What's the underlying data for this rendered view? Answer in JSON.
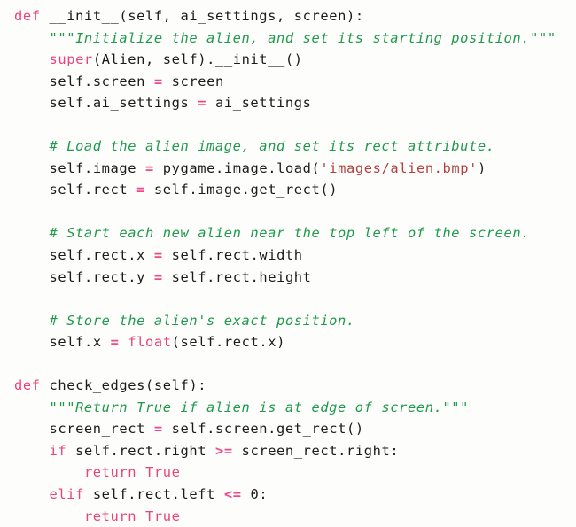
{
  "document": {
    "kind": "code-listing",
    "language": "python",
    "theme": {
      "background": "#fdfdfb",
      "default_text": "#1b1b1b",
      "keyword": "#e8437f",
      "builtin": "#e8437f",
      "operator": "#f0488a",
      "comment": "#1f9a4d",
      "docstring": "#1f9a4d",
      "string": "#b3403f",
      "number": "#1b1b1b"
    },
    "plain_text": "def __init__(self, ai_settings, screen):\n    \"\"\"Initialize the alien, and set its starting position.\"\"\"\n    super(Alien, self).__init__()\n    self.screen = screen\n    self.ai_settings = ai_settings\n\n    # Load the alien image, and set its rect attribute.\n    self.image = pygame.image.load('images/alien.bmp')\n    self.rect = self.image.get_rect()\n\n    # Start each new alien near the top left of the screen.\n    self.rect.x = self.rect.width\n    self.rect.y = self.rect.height\n\n    # Store the alien's exact position.\n    self.x = float(self.rect.x)\n\ndef check_edges(self):\n    \"\"\"Return True if alien is at edge of screen.\"\"\"\n    screen_rect = self.screen.get_rect()\n    if self.rect.right >= screen_rect.right:\n        return True\n    elif self.rect.left <= 0:\n        return True",
    "lines": [
      {
        "index": 1,
        "indent": 0,
        "tokens": [
          {
            "t": "def",
            "k": "kw"
          },
          {
            "t": " ",
            "k": "plain"
          },
          {
            "t": "__init__",
            "k": "name"
          },
          {
            "t": "(",
            "k": "punct"
          },
          {
            "t": "self",
            "k": "name"
          },
          {
            "t": ", ",
            "k": "punct"
          },
          {
            "t": "ai_settings",
            "k": "name"
          },
          {
            "t": ", ",
            "k": "punct"
          },
          {
            "t": "screen",
            "k": "name"
          },
          {
            "t": "):",
            "k": "punct"
          }
        ]
      },
      {
        "index": 2,
        "indent": 1,
        "tokens": [
          {
            "t": "\"\"\"Initialize the alien, and set its starting position.\"\"\"",
            "k": "doc"
          }
        ]
      },
      {
        "index": 3,
        "indent": 1,
        "tokens": [
          {
            "t": "super",
            "k": "builtin"
          },
          {
            "t": "(",
            "k": "punct"
          },
          {
            "t": "Alien",
            "k": "name"
          },
          {
            "t": ", ",
            "k": "punct"
          },
          {
            "t": "self",
            "k": "name"
          },
          {
            "t": ").",
            "k": "punct"
          },
          {
            "t": "__init__",
            "k": "name"
          },
          {
            "t": "()",
            "k": "punct"
          }
        ]
      },
      {
        "index": 4,
        "indent": 1,
        "tokens": [
          {
            "t": "self",
            "k": "name"
          },
          {
            "t": ".",
            "k": "punct"
          },
          {
            "t": "screen",
            "k": "name"
          },
          {
            "t": " ",
            "k": "plain"
          },
          {
            "t": "=",
            "k": "op"
          },
          {
            "t": " ",
            "k": "plain"
          },
          {
            "t": "screen",
            "k": "name"
          }
        ]
      },
      {
        "index": 5,
        "indent": 1,
        "tokens": [
          {
            "t": "self",
            "k": "name"
          },
          {
            "t": ".",
            "k": "punct"
          },
          {
            "t": "ai_settings",
            "k": "name"
          },
          {
            "t": " ",
            "k": "plain"
          },
          {
            "t": "=",
            "k": "op"
          },
          {
            "t": " ",
            "k": "plain"
          },
          {
            "t": "ai_settings",
            "k": "name"
          }
        ]
      },
      {
        "index": 6,
        "indent": 0,
        "blank": true,
        "tokens": []
      },
      {
        "index": 7,
        "indent": 1,
        "tokens": [
          {
            "t": "# Load the alien image, and set its rect attribute.",
            "k": "comment"
          }
        ]
      },
      {
        "index": 8,
        "indent": 1,
        "tokens": [
          {
            "t": "self",
            "k": "name"
          },
          {
            "t": ".",
            "k": "punct"
          },
          {
            "t": "image",
            "k": "name"
          },
          {
            "t": " ",
            "k": "plain"
          },
          {
            "t": "=",
            "k": "op"
          },
          {
            "t": " ",
            "k": "plain"
          },
          {
            "t": "pygame",
            "k": "name"
          },
          {
            "t": ".",
            "k": "punct"
          },
          {
            "t": "image",
            "k": "name"
          },
          {
            "t": ".",
            "k": "punct"
          },
          {
            "t": "load",
            "k": "name"
          },
          {
            "t": "(",
            "k": "punct"
          },
          {
            "t": "'images/alien.bmp'",
            "k": "str"
          },
          {
            "t": ")",
            "k": "punct"
          }
        ]
      },
      {
        "index": 9,
        "indent": 1,
        "tokens": [
          {
            "t": "self",
            "k": "name"
          },
          {
            "t": ".",
            "k": "punct"
          },
          {
            "t": "rect",
            "k": "name"
          },
          {
            "t": " ",
            "k": "plain"
          },
          {
            "t": "=",
            "k": "op"
          },
          {
            "t": " ",
            "k": "plain"
          },
          {
            "t": "self",
            "k": "name"
          },
          {
            "t": ".",
            "k": "punct"
          },
          {
            "t": "image",
            "k": "name"
          },
          {
            "t": ".",
            "k": "punct"
          },
          {
            "t": "get_rect",
            "k": "name"
          },
          {
            "t": "()",
            "k": "punct"
          }
        ]
      },
      {
        "index": 10,
        "indent": 0,
        "blank": true,
        "tokens": []
      },
      {
        "index": 11,
        "indent": 1,
        "tokens": [
          {
            "t": "# Start each new alien near the top left of the screen.",
            "k": "comment"
          }
        ]
      },
      {
        "index": 12,
        "indent": 1,
        "tokens": [
          {
            "t": "self",
            "k": "name"
          },
          {
            "t": ".",
            "k": "punct"
          },
          {
            "t": "rect",
            "k": "name"
          },
          {
            "t": ".",
            "k": "punct"
          },
          {
            "t": "x",
            "k": "name"
          },
          {
            "t": " ",
            "k": "plain"
          },
          {
            "t": "=",
            "k": "op"
          },
          {
            "t": " ",
            "k": "plain"
          },
          {
            "t": "self",
            "k": "name"
          },
          {
            "t": ".",
            "k": "punct"
          },
          {
            "t": "rect",
            "k": "name"
          },
          {
            "t": ".",
            "k": "punct"
          },
          {
            "t": "width",
            "k": "name"
          }
        ]
      },
      {
        "index": 13,
        "indent": 1,
        "tokens": [
          {
            "t": "self",
            "k": "name"
          },
          {
            "t": ".",
            "k": "punct"
          },
          {
            "t": "rect",
            "k": "name"
          },
          {
            "t": ".",
            "k": "punct"
          },
          {
            "t": "y",
            "k": "name"
          },
          {
            "t": " ",
            "k": "plain"
          },
          {
            "t": "=",
            "k": "op"
          },
          {
            "t": " ",
            "k": "plain"
          },
          {
            "t": "self",
            "k": "name"
          },
          {
            "t": ".",
            "k": "punct"
          },
          {
            "t": "rect",
            "k": "name"
          },
          {
            "t": ".",
            "k": "punct"
          },
          {
            "t": "height",
            "k": "name"
          }
        ]
      },
      {
        "index": 14,
        "indent": 0,
        "blank": true,
        "tokens": []
      },
      {
        "index": 15,
        "indent": 1,
        "tokens": [
          {
            "t": "# Store the alien's exact position.",
            "k": "comment"
          }
        ]
      },
      {
        "index": 16,
        "indent": 1,
        "tokens": [
          {
            "t": "self",
            "k": "name"
          },
          {
            "t": ".",
            "k": "punct"
          },
          {
            "t": "x",
            "k": "name"
          },
          {
            "t": " ",
            "k": "plain"
          },
          {
            "t": "=",
            "k": "op"
          },
          {
            "t": " ",
            "k": "plain"
          },
          {
            "t": "float",
            "k": "builtin"
          },
          {
            "t": "(",
            "k": "punct"
          },
          {
            "t": "self",
            "k": "name"
          },
          {
            "t": ".",
            "k": "punct"
          },
          {
            "t": "rect",
            "k": "name"
          },
          {
            "t": ".",
            "k": "punct"
          },
          {
            "t": "x",
            "k": "name"
          },
          {
            "t": ")",
            "k": "punct"
          }
        ]
      },
      {
        "index": 17,
        "indent": 0,
        "blank": true,
        "tokens": []
      },
      {
        "index": 18,
        "indent": 0,
        "tokens": [
          {
            "t": "def",
            "k": "kw"
          },
          {
            "t": " ",
            "k": "plain"
          },
          {
            "t": "check_edges",
            "k": "name"
          },
          {
            "t": "(",
            "k": "punct"
          },
          {
            "t": "self",
            "k": "name"
          },
          {
            "t": "):",
            "k": "punct"
          }
        ]
      },
      {
        "index": 19,
        "indent": 1,
        "tokens": [
          {
            "t": "\"\"\"Return True if alien is at edge of screen.\"\"\"",
            "k": "doc"
          }
        ]
      },
      {
        "index": 20,
        "indent": 1,
        "tokens": [
          {
            "t": "screen_rect",
            "k": "name"
          },
          {
            "t": " ",
            "k": "plain"
          },
          {
            "t": "=",
            "k": "op"
          },
          {
            "t": " ",
            "k": "plain"
          },
          {
            "t": "self",
            "k": "name"
          },
          {
            "t": ".",
            "k": "punct"
          },
          {
            "t": "screen",
            "k": "name"
          },
          {
            "t": ".",
            "k": "punct"
          },
          {
            "t": "get_rect",
            "k": "name"
          },
          {
            "t": "()",
            "k": "punct"
          }
        ]
      },
      {
        "index": 21,
        "indent": 1,
        "tokens": [
          {
            "t": "if",
            "k": "kw"
          },
          {
            "t": " ",
            "k": "plain"
          },
          {
            "t": "self",
            "k": "name"
          },
          {
            "t": ".",
            "k": "punct"
          },
          {
            "t": "rect",
            "k": "name"
          },
          {
            "t": ".",
            "k": "punct"
          },
          {
            "t": "right",
            "k": "name"
          },
          {
            "t": " ",
            "k": "plain"
          },
          {
            "t": ">=",
            "k": "op"
          },
          {
            "t": " ",
            "k": "plain"
          },
          {
            "t": "screen_rect",
            "k": "name"
          },
          {
            "t": ".",
            "k": "punct"
          },
          {
            "t": "right",
            "k": "name"
          },
          {
            "t": ":",
            "k": "punct"
          }
        ]
      },
      {
        "index": 22,
        "indent": 2,
        "tokens": [
          {
            "t": "return",
            "k": "kw"
          },
          {
            "t": " ",
            "k": "plain"
          },
          {
            "t": "True",
            "k": "kw"
          }
        ]
      },
      {
        "index": 23,
        "indent": 1,
        "tokens": [
          {
            "t": "elif",
            "k": "kw"
          },
          {
            "t": " ",
            "k": "plain"
          },
          {
            "t": "self",
            "k": "name"
          },
          {
            "t": ".",
            "k": "punct"
          },
          {
            "t": "rect",
            "k": "name"
          },
          {
            "t": ".",
            "k": "punct"
          },
          {
            "t": "left",
            "k": "name"
          },
          {
            "t": " ",
            "k": "plain"
          },
          {
            "t": "<=",
            "k": "op"
          },
          {
            "t": " ",
            "k": "plain"
          },
          {
            "t": "0",
            "k": "num"
          },
          {
            "t": ":",
            "k": "punct"
          }
        ]
      },
      {
        "index": 24,
        "indent": 2,
        "tokens": [
          {
            "t": "return",
            "k": "kw"
          },
          {
            "t": " ",
            "k": "plain"
          },
          {
            "t": "True",
            "k": "kw"
          }
        ]
      }
    ]
  }
}
